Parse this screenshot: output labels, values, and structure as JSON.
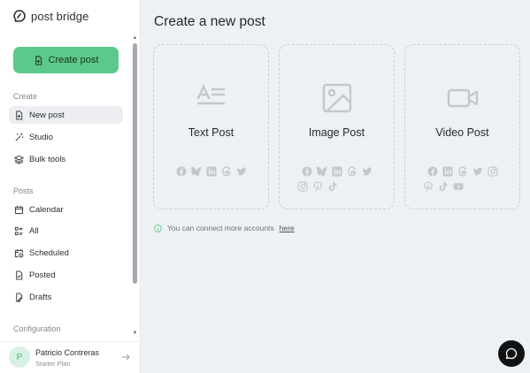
{
  "app": {
    "name": "post bridge"
  },
  "sidebar": {
    "create_button": "Create post",
    "sections": {
      "create": "Create",
      "posts": "Posts",
      "configuration": "Configuration"
    },
    "create_items": [
      {
        "label": "New post",
        "icon": "file-plus-icon",
        "active": true
      },
      {
        "label": "Studio",
        "icon": "magic-wand-icon"
      },
      {
        "label": "Bulk tools",
        "icon": "layers-icon"
      }
    ],
    "post_items": [
      {
        "label": "Calendar",
        "icon": "calendar-icon"
      },
      {
        "label": "All",
        "icon": "list-icon"
      },
      {
        "label": "Scheduled",
        "icon": "calendar-clock-icon"
      },
      {
        "label": "Posted",
        "icon": "file-check-icon"
      },
      {
        "label": "Drafts",
        "icon": "file-edit-icon"
      }
    ]
  },
  "profile": {
    "initial": "P",
    "name": "Patricio Contreras",
    "plan": "Starter Plan"
  },
  "main": {
    "title": "Create a new post",
    "cards": [
      {
        "label": "Text Post",
        "icon": "text-lines-icon",
        "platforms": [
          [
            "facebook",
            "bluesky",
            "linkedin",
            "threads",
            "twitter"
          ]
        ]
      },
      {
        "label": "Image Post",
        "icon": "image-icon",
        "platforms": [
          [
            "facebook",
            "bluesky",
            "linkedin",
            "threads",
            "twitter"
          ],
          [
            "instagram",
            "pinterest",
            "tiktok"
          ]
        ]
      },
      {
        "label": "Video Post",
        "icon": "video-icon",
        "platforms": [
          [
            "facebook",
            "linkedin",
            "threads",
            "twitter",
            "instagram"
          ],
          [
            "pinterest",
            "tiktok",
            "youtube"
          ]
        ]
      }
    ],
    "info_text": "You can connect more accounts",
    "info_link": "here"
  },
  "colors": {
    "accent": "#5cc98a",
    "icon_muted": "#c3c7cc",
    "chat_button": "#0f1113"
  }
}
